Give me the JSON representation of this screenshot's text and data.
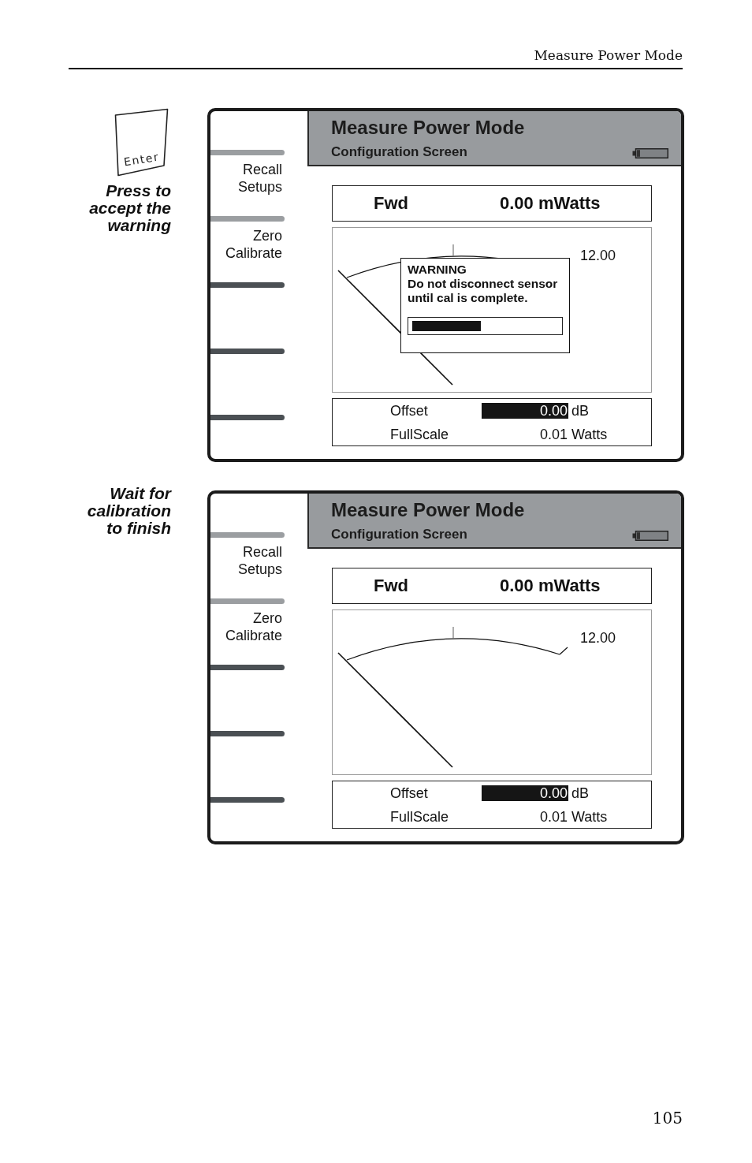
{
  "page_header": {
    "title": "Measure Power Mode"
  },
  "steps": [
    {
      "key": {
        "label": "Enter"
      },
      "caption": "Press to\naccept the\nwarning",
      "screen": {
        "title": "Measure Power Mode",
        "subtitle": "Configuration Screen",
        "softkeys": [
          {
            "label": "Recall\nSetups",
            "active": true
          },
          {
            "label": "Zero\nCalibrate",
            "active": true
          },
          {
            "active": false
          },
          {
            "active": false
          },
          {
            "active": false
          }
        ],
        "reading": {
          "name": "Fwd",
          "value": "0.00 mWatts"
        },
        "meter": {
          "scale_max": "12.00"
        },
        "dialog": {
          "title": "WARNING",
          "message": "Do not disconnect sensor\nuntil cal is complete.",
          "progress": {
            "level": 0.47
          }
        },
        "settings": [
          {
            "name": "Offset",
            "value": "0.00",
            "unit": "dB",
            "highlighted": true
          },
          {
            "name": "FullScale",
            "value": "0.01",
            "unit": "Watts",
            "highlighted": false
          }
        ]
      }
    },
    {
      "caption": "Wait for\ncalibration\nto finish",
      "screen": {
        "title": "Measure Power Mode",
        "subtitle": "Configuration Screen",
        "softkeys": [
          {
            "label": "Recall\nSetups",
            "active": true
          },
          {
            "label": "Zero\nCalibrate",
            "active": true
          },
          {
            "active": false
          },
          {
            "active": false
          },
          {
            "active": false
          }
        ],
        "reading": {
          "name": "Fwd",
          "value": "0.00 mWatts"
        },
        "meter": {
          "scale_max": "12.00"
        },
        "settings": [
          {
            "name": "Offset",
            "value": "0.00",
            "unit": "dB",
            "highlighted": true
          },
          {
            "name": "FullScale",
            "value": "0.01",
            "unit": "Watts",
            "highlighted": false
          }
        ]
      }
    }
  ],
  "page_number": "105"
}
